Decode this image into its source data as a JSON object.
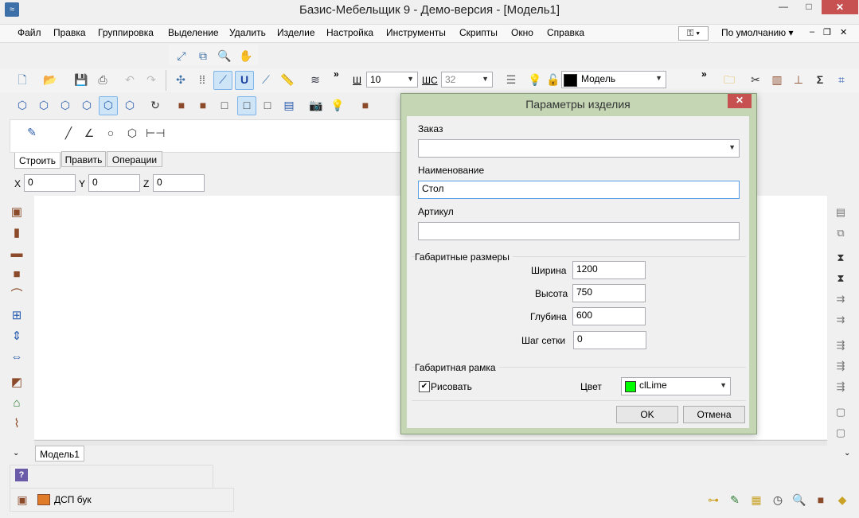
{
  "window": {
    "title": "Базис-Мебельщик 9 - Демо-версия - [Модель1]",
    "minimize": "—",
    "maximize": "□",
    "close": "✕"
  },
  "menu": {
    "items": [
      "Файл",
      "Правка",
      "Группировка",
      "Выделение",
      "Удалить",
      "Изделие",
      "Настройка",
      "Инструменты",
      "Скрипты",
      "Окно",
      "Справка"
    ],
    "key_icon": "key-icon",
    "profile": "По умолчанию"
  },
  "toolbar": {
    "sh_label": "Ш",
    "sh_value": "10",
    "shs_label": "ШС",
    "shs_value": "32",
    "layer_value": "Модель",
    "more": "»"
  },
  "build_tabs": {
    "tabs": [
      "Строить",
      "Править",
      "Операции"
    ],
    "active": "Строить"
  },
  "coords": {
    "x_label": "X",
    "x_value": "0",
    "y_label": "Y",
    "y_value": "0",
    "z_label": "Z",
    "z_value": "0"
  },
  "dialog": {
    "title": "Параметры изделия",
    "close": "✕",
    "order_label": "Заказ",
    "order_value": "",
    "name_label": "Наименование",
    "name_value": "Стол",
    "article_label": "Артикул",
    "article_value": "",
    "dims_group": "Габаритные размеры",
    "width_label": "Ширина",
    "width_value": "1200",
    "height_label": "Высота",
    "height_value": "750",
    "depth_label": "Глубина",
    "depth_value": "600",
    "grid_label": "Шаг сетки",
    "grid_value": "0",
    "frame_group": "Габаритная рамка",
    "draw_label": "Рисовать",
    "draw_checked": "✔",
    "color_label": "Цвет",
    "color_value": "clLime",
    "color_hex": "#00ff00",
    "ok": "OK",
    "cancel": "Отмена"
  },
  "doc_tabs": {
    "tab": "Модель1"
  },
  "statusbar": {
    "material": "ДСП бук",
    "help": "?"
  }
}
